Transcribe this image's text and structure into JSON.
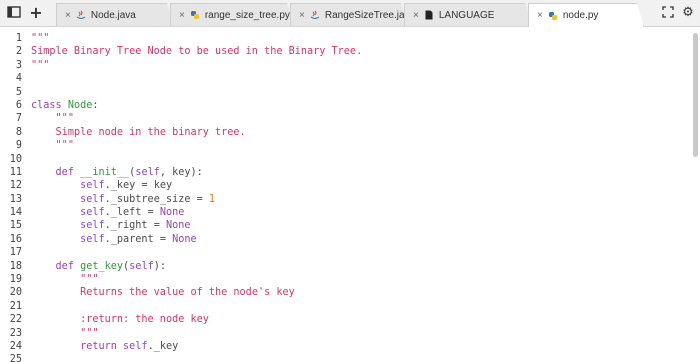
{
  "tabbar": {
    "tabs": [
      {
        "label": "Node.java",
        "icon": "java-icon",
        "active": false
      },
      {
        "label": "range_size_tree.py",
        "icon": "python-icon",
        "active": false
      },
      {
        "label": "RangeSizeTree.java",
        "icon": "java-icon",
        "active": false
      },
      {
        "label": "LANGUAGE",
        "icon": "document-icon",
        "active": false
      },
      {
        "label": "node.py",
        "icon": "python-icon",
        "active": true
      }
    ],
    "close_glyph": "×",
    "new_tab_glyph": "+"
  },
  "colors": {
    "keyword": "#9c3fb0",
    "string": "#d6336c",
    "definition": "#2e9a3a",
    "self": "#8a48c8",
    "number": "#e07b1a",
    "text": "#4c4c4c"
  },
  "editor": {
    "language": "python",
    "lines": [
      [
        {
          "t": "\"\"\"",
          "k": "str"
        }
      ],
      [
        {
          "t": "Simple Binary Tree Node to be used in the Binary Tree.",
          "k": "str"
        }
      ],
      [
        {
          "t": "\"\"\"",
          "k": "str"
        }
      ],
      [],
      [],
      [
        {
          "t": "class ",
          "k": "kw"
        },
        {
          "t": "Node",
          "k": "def"
        },
        {
          "t": ":",
          "k": "txt"
        }
      ],
      [
        {
          "t": "    ",
          "k": "txt"
        },
        {
          "t": "\"\"\"",
          "k": "str"
        }
      ],
      [
        {
          "t": "    ",
          "k": "txt"
        },
        {
          "t": "Simple node in the binary tree.",
          "k": "str"
        }
      ],
      [
        {
          "t": "    ",
          "k": "txt"
        },
        {
          "t": "\"\"\"",
          "k": "str"
        }
      ],
      [],
      [
        {
          "t": "    ",
          "k": "txt"
        },
        {
          "t": "def ",
          "k": "kw"
        },
        {
          "t": "__init__",
          "k": "def"
        },
        {
          "t": "(",
          "k": "txt"
        },
        {
          "t": "self",
          "k": "self"
        },
        {
          "t": ", key):",
          "k": "txt"
        }
      ],
      [
        {
          "t": "        ",
          "k": "txt"
        },
        {
          "t": "self",
          "k": "self"
        },
        {
          "t": "._key = key",
          "k": "txt"
        }
      ],
      [
        {
          "t": "        ",
          "k": "txt"
        },
        {
          "t": "self",
          "k": "self"
        },
        {
          "t": "._subtree_size = ",
          "k": "txt"
        },
        {
          "t": "1",
          "k": "num"
        }
      ],
      [
        {
          "t": "        ",
          "k": "txt"
        },
        {
          "t": "self",
          "k": "self"
        },
        {
          "t": "._left = ",
          "k": "txt"
        },
        {
          "t": "None",
          "k": "kw"
        }
      ],
      [
        {
          "t": "        ",
          "k": "txt"
        },
        {
          "t": "self",
          "k": "self"
        },
        {
          "t": "._right = ",
          "k": "txt"
        },
        {
          "t": "None",
          "k": "kw"
        }
      ],
      [
        {
          "t": "        ",
          "k": "txt"
        },
        {
          "t": "self",
          "k": "self"
        },
        {
          "t": "._parent = ",
          "k": "txt"
        },
        {
          "t": "None",
          "k": "kw"
        }
      ],
      [],
      [
        {
          "t": "    ",
          "k": "txt"
        },
        {
          "t": "def ",
          "k": "kw"
        },
        {
          "t": "get_key",
          "k": "def"
        },
        {
          "t": "(",
          "k": "txt"
        },
        {
          "t": "self",
          "k": "self"
        },
        {
          "t": "):",
          "k": "txt"
        }
      ],
      [
        {
          "t": "        ",
          "k": "txt"
        },
        {
          "t": "\"\"\"",
          "k": "str"
        }
      ],
      [
        {
          "t": "        ",
          "k": "txt"
        },
        {
          "t": "Returns the value of the node's key",
          "k": "str"
        }
      ],
      [],
      [
        {
          "t": "        ",
          "k": "txt"
        },
        {
          "t": ":return: the node key",
          "k": "str"
        }
      ],
      [
        {
          "t": "        ",
          "k": "txt"
        },
        {
          "t": "\"\"\"",
          "k": "str"
        }
      ],
      [
        {
          "t": "        ",
          "k": "txt"
        },
        {
          "t": "return ",
          "k": "kw"
        },
        {
          "t": "self",
          "k": "self"
        },
        {
          "t": "._key",
          "k": "txt"
        }
      ],
      []
    ]
  }
}
